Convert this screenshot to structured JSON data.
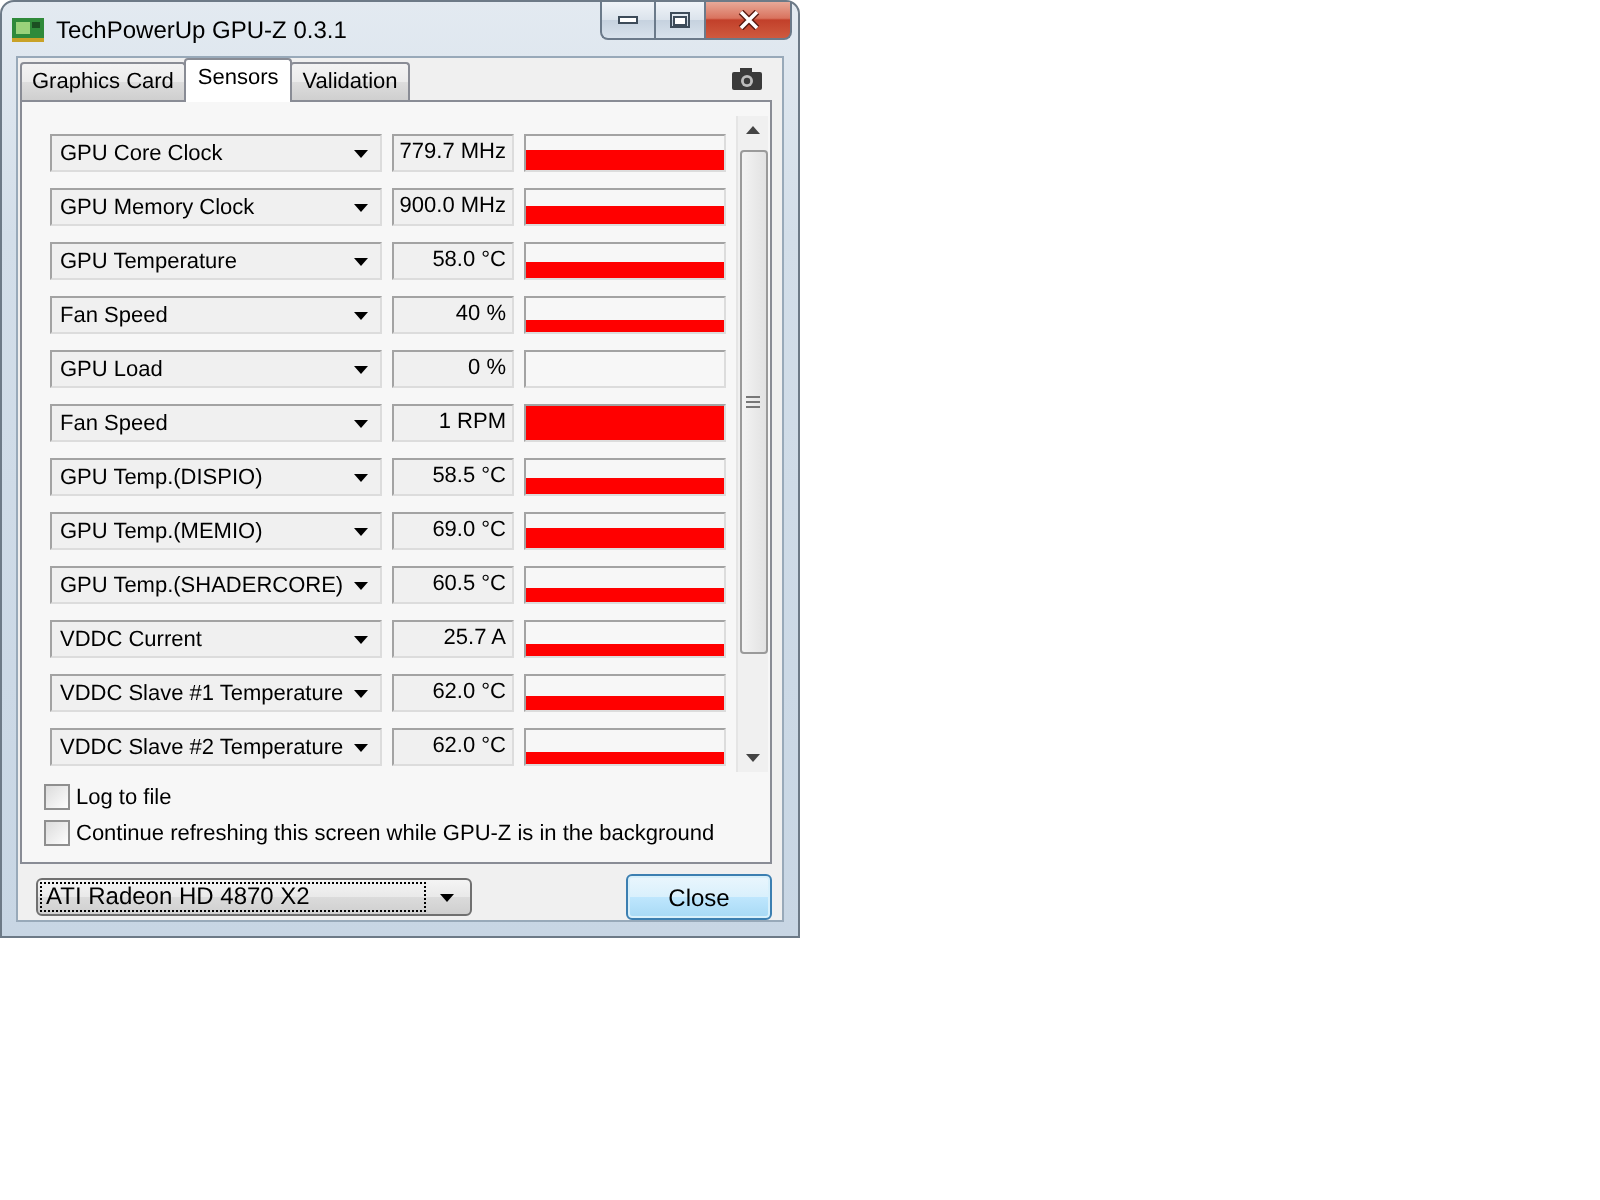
{
  "window": {
    "title": "TechPowerUp GPU-Z 0.3.1"
  },
  "tabs": [
    {
      "label": "Graphics Card",
      "selected": false
    },
    {
      "label": "Sensors",
      "selected": true
    },
    {
      "label": "Validation",
      "selected": false
    }
  ],
  "sensors": [
    {
      "name": "GPU Core Clock",
      "reading": "779.7 MHz"
    },
    {
      "name": "GPU Memory Clock",
      "reading": "900.0 MHz"
    },
    {
      "name": "GPU Temperature",
      "reading": "58.0 °C"
    },
    {
      "name": "Fan Speed",
      "reading": "40 %"
    },
    {
      "name": "GPU Load",
      "reading": "0 %"
    },
    {
      "name": "Fan Speed",
      "reading": "1 RPM"
    },
    {
      "name": "GPU Temp.(DISPIO)",
      "reading": "58.5 °C"
    },
    {
      "name": "GPU Temp.(MEMIO)",
      "reading": "69.0 °C"
    },
    {
      "name": "GPU Temp.(SHADERCORE)",
      "reading": "60.5 °C"
    },
    {
      "name": "VDDC Current",
      "reading": "25.7 A"
    },
    {
      "name": "VDDC Slave #1 Temperature",
      "reading": "62.0 °C"
    },
    {
      "name": "VDDC Slave #2 Temperature",
      "reading": "62.0 °C"
    }
  ],
  "options": [
    {
      "label": "Log to file",
      "checked": false
    },
    {
      "label": "Continue refreshing this screen while GPU-Z is in the background",
      "checked": false
    }
  ],
  "device_select": {
    "value": "ATI Radeon HD 4870 X2"
  },
  "close_button": {
    "label": "Close"
  }
}
